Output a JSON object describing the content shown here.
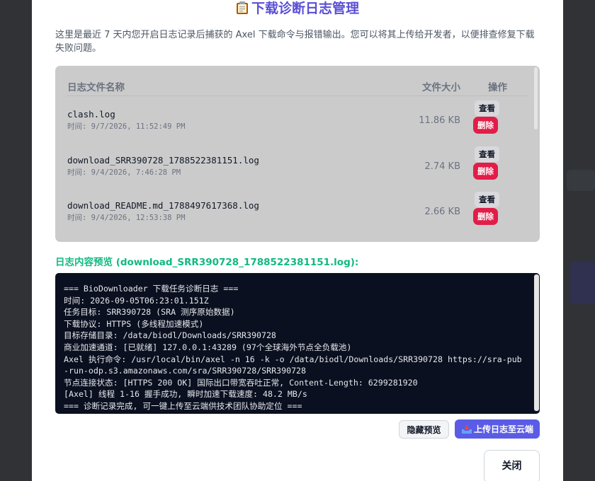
{
  "modal": {
    "title": "下载诊断日志管理",
    "description": "这里是最近 7 天内您开启日志记录后捕获的 Axel 下载命令与报错输出。您可以将其上传给开发者，以便排查修复下载失败问题。"
  },
  "files_table": {
    "headers": {
      "name": "日志文件名称",
      "size": "文件大小",
      "actions": "操作"
    },
    "rows": [
      {
        "name": "clash.log",
        "time": "时间: 9/7/2026, 11:52:49 PM",
        "size": "11.86 KB",
        "view": "查看",
        "delete": "删除"
      },
      {
        "name": "download_SRR390728_1788522381151.log",
        "time": "时间: 9/4/2026, 7:46:28 PM",
        "size": "2.74 KB",
        "view": "查看",
        "delete": "删除"
      },
      {
        "name": "download_README.md_1788497617368.log",
        "time": "时间: 9/4/2026, 12:53:38 PM",
        "size": "2.66 KB",
        "view": "查看",
        "delete": "删除"
      }
    ]
  },
  "preview": {
    "label": "日志内容预览 (download_SRR390728_1788522381151.log):",
    "lines": [
      "=== BioDownloader 下载任务诊断日志 ===",
      "时间: 2026-09-05T06:23:01.151Z",
      "任务目标: SRR390728 (SRA 测序原始数据)",
      "下载协议: HTTPS (多线程加速模式)",
      "目标存储目录: /data/biodl/Downloads/SRR390728",
      "商业加速通道: [已就绪] 127.0.0.1:43289 (97个全球海外节点全负载池)",
      "Axel 执行命令: /usr/local/bin/axel -n 16 -k -o /data/biodl/Downloads/SRR390728 https://sra-pub-run-odp.s3.amazonaws.com/sra/SRR390728/SRR390728",
      "节点连接状态: [HTTPS 200 OK] 国际出口带宽吞吐正常, Content-Length: 6299281920",
      "[Axel] 线程 1-16 握手成功, 瞬时加速下载速度: 48.2 MB/s",
      "=== 诊断记录完成, 可一键上传至云端供技术团队协助定位 ==="
    ]
  },
  "buttons": {
    "hide_preview": "隐藏预览",
    "upload": "上传日志至云端",
    "close": "关闭"
  },
  "colors": {
    "title": "#5b4fd6",
    "preview_label": "#10b981",
    "delete": "#e11d48",
    "upload": "#5b5ce6",
    "console_bg": "#0b1020"
  },
  "icons": {
    "title": "clipboard-icon",
    "upload": "inbox-tray-icon"
  }
}
